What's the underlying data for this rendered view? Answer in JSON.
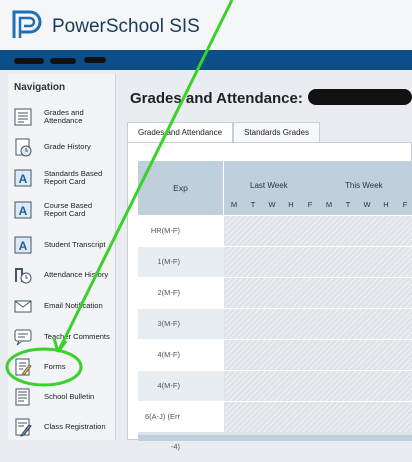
{
  "app": {
    "title": "PowerSchool SIS"
  },
  "sidebar": {
    "heading": "Navigation",
    "items": [
      {
        "label": "Grades and Attendance",
        "icon": "grades-attendance-icon"
      },
      {
        "label": "Grade History",
        "icon": "grade-history-icon"
      },
      {
        "label": "Standards Based Report Card",
        "icon": "report-card-icon"
      },
      {
        "label": "Course Based Report Card",
        "icon": "report-card-icon"
      },
      {
        "label": "Student Transcript",
        "icon": "transcript-icon"
      },
      {
        "label": "Attendance History",
        "icon": "attendance-history-icon"
      },
      {
        "label": "Email Notification",
        "icon": "email-icon"
      },
      {
        "label": "Teacher Comments",
        "icon": "comments-icon"
      },
      {
        "label": "Forms",
        "icon": "forms-icon"
      },
      {
        "label": "School Bulletin",
        "icon": "bulletin-icon"
      },
      {
        "label": "Class Registration",
        "icon": "registration-icon"
      }
    ]
  },
  "main": {
    "title": "Grades and Attendance:",
    "tabs": [
      {
        "label": "Grades and Attendance",
        "active": true
      },
      {
        "label": "Standards Grades",
        "active": false
      }
    ],
    "table": {
      "exp_header": "Exp",
      "weeks": [
        "Last Week",
        "This Week"
      ],
      "days": [
        "M",
        "T",
        "W",
        "H",
        "F",
        "M",
        "T",
        "W",
        "H",
        "F"
      ],
      "rows": [
        "HR(M-F)",
        "1(M-F)",
        "2(M-F)",
        "3(M-F)",
        "4(M-F)",
        "4(M-F)",
        "6(A-J) (Err -4)"
      ]
    }
  },
  "colors": {
    "header_bar": "#0b4e88",
    "highlight": "#39d12a"
  }
}
